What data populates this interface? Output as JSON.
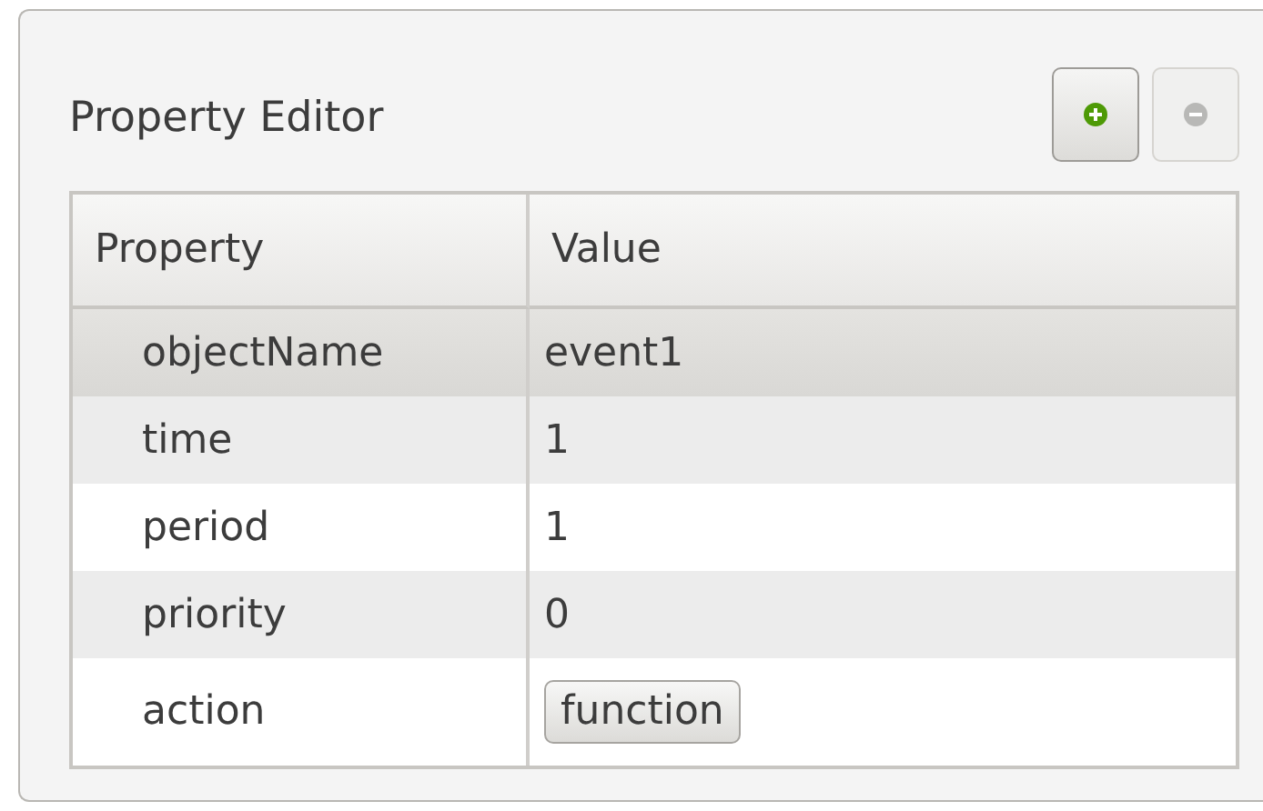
{
  "panel": {
    "title": "Property Editor"
  },
  "toolbar": [
    {
      "kind": "add",
      "disabled": false
    },
    {
      "kind": "remove",
      "disabled": true
    }
  ],
  "table": {
    "columns": [
      "Property",
      "Value"
    ],
    "rows": [
      {
        "name": "objectName",
        "value": "event1",
        "kind": "text",
        "selected": true
      },
      {
        "name": "time",
        "value": "1",
        "kind": "text",
        "selected": false
      },
      {
        "name": "period",
        "value": "1",
        "kind": "text",
        "selected": false
      },
      {
        "name": "priority",
        "value": "0",
        "kind": "text",
        "selected": false
      },
      {
        "name": "action",
        "value": "function",
        "kind": "button",
        "selected": false
      }
    ]
  }
}
